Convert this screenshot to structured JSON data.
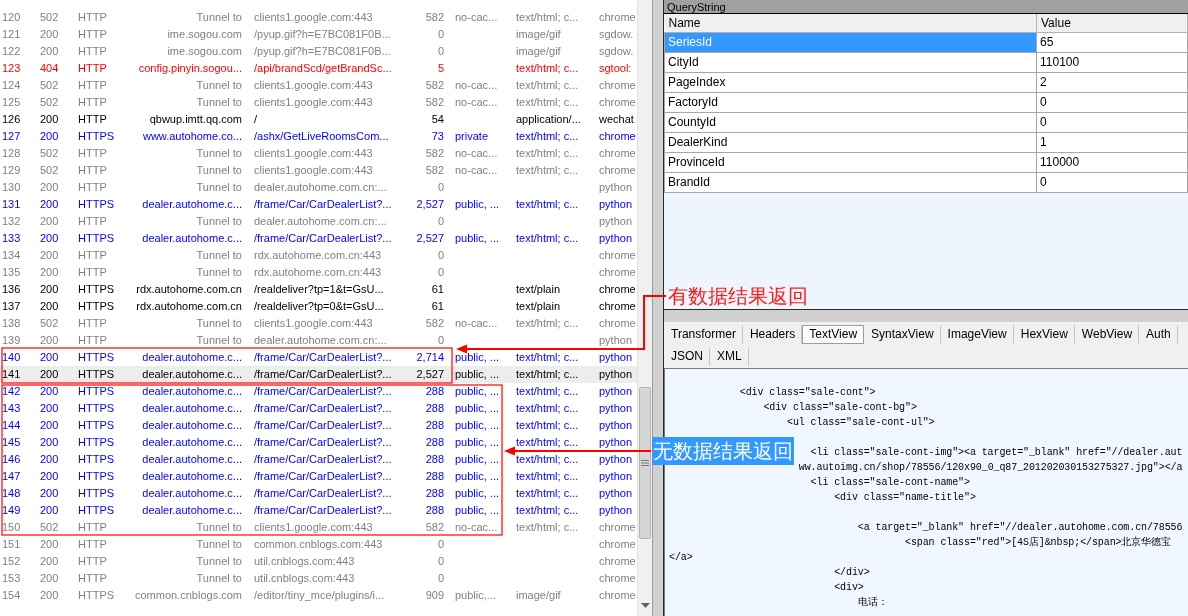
{
  "sessions": {
    "rows": [
      {
        "num": "120",
        "result": "502",
        "protocol": "HTTP",
        "host": "Tunnel to",
        "url": "clients1.google.com:443",
        "body": "582",
        "caching": "no-cac...",
        "content_type": "text/html; c...",
        "process": "chrome",
        "kind": "tunnel",
        "selected": false
      },
      {
        "num": "121",
        "result": "200",
        "protocol": "HTTP",
        "host": "ime.sogou.com",
        "url": "/pyup.gif?h=E7BC081F0B...",
        "body": "0",
        "content_type": "image/gif",
        "process": "sgdow.",
        "kind": "image",
        "selected": false
      },
      {
        "num": "122",
        "result": "200",
        "protocol": "HTTP",
        "host": "ime.sogou.com",
        "url": "/pyup.gif?h=E7BC081F0B...",
        "body": "0",
        "content_type": "image/gif",
        "process": "sgdow.",
        "kind": "image",
        "selected": false
      },
      {
        "num": "123",
        "result": "404",
        "protocol": "HTTP",
        "host": "config.pinyin.sogou...",
        "url": "/api/brandScd/getBrandSc...",
        "body": "5",
        "content_type": "text/html; c...",
        "process": "sgtool:",
        "kind": "error",
        "selected": false
      },
      {
        "num": "124",
        "result": "502",
        "protocol": "HTTP",
        "host": "Tunnel to",
        "url": "clients1.google.com:443",
        "body": "582",
        "caching": "no-cac...",
        "content_type": "text/html; c...",
        "process": "chrome",
        "kind": "tunnel",
        "selected": false
      },
      {
        "num": "125",
        "result": "502",
        "protocol": "HTTP",
        "host": "Tunnel to",
        "url": "clients1.google.com:443",
        "body": "582",
        "caching": "no-cac...",
        "content_type": "text/html; c...",
        "process": "chrome",
        "kind": "tunnel",
        "selected": false
      },
      {
        "num": "126",
        "result": "200",
        "protocol": "HTTP",
        "host": "qbwup.imtt.qq.com",
        "url": "/",
        "body": "54",
        "content_type": "application/...",
        "process": "wechat",
        "kind": "other",
        "selected": false
      },
      {
        "num": "127",
        "result": "200",
        "protocol": "HTTPS",
        "host": "www.autohome.co...",
        "url": "/ashx/GetLiveRoomsCom...",
        "body": "73",
        "caching": "private",
        "content_type": "text/html; c...",
        "process": "chrome",
        "kind": "html",
        "selected": false
      },
      {
        "num": "128",
        "result": "502",
        "protocol": "HTTP",
        "host": "Tunnel to",
        "url": "clients1.google.com:443",
        "body": "582",
        "caching": "no-cac...",
        "content_type": "text/html; c...",
        "process": "chrome",
        "kind": "tunnel",
        "selected": false
      },
      {
        "num": "129",
        "result": "502",
        "protocol": "HTTP",
        "host": "Tunnel to",
        "url": "clients1.google.com:443",
        "body": "582",
        "caching": "no-cac...",
        "content_type": "text/html; c...",
        "process": "chrome",
        "kind": "tunnel",
        "selected": false
      },
      {
        "num": "130",
        "result": "200",
        "protocol": "HTTP",
        "host": "Tunnel to",
        "url": "dealer.autohome.com.cn:...",
        "body": "0",
        "process": "python",
        "kind": "tunnel",
        "selected": false
      },
      {
        "num": "131",
        "result": "200",
        "protocol": "HTTPS",
        "host": "dealer.autohome.c...",
        "url": "/frame/Car/CarDealerList?...",
        "body": "2,527",
        "caching": "public, ...",
        "content_type": "text/html; c...",
        "process": "python",
        "kind": "html",
        "selected": false
      },
      {
        "num": "132",
        "result": "200",
        "protocol": "HTTP",
        "host": "Tunnel to",
        "url": "dealer.autohome.com.cn:...",
        "body": "0",
        "process": "python",
        "kind": "tunnel",
        "selected": false
      },
      {
        "num": "133",
        "result": "200",
        "protocol": "HTTPS",
        "host": "dealer.autohome.c...",
        "url": "/frame/Car/CarDealerList?...",
        "body": "2,527",
        "caching": "public, ...",
        "content_type": "text/html; c...",
        "process": "python",
        "kind": "html",
        "selected": false
      },
      {
        "num": "134",
        "result": "200",
        "protocol": "HTTP",
        "host": "Tunnel to",
        "url": "rdx.autohome.com.cn:443",
        "body": "0",
        "process": "chrome",
        "kind": "tunnel",
        "selected": false
      },
      {
        "num": "135",
        "result": "200",
        "protocol": "HTTP",
        "host": "Tunnel to",
        "url": "rdx.autohome.com.cn:443",
        "body": "0",
        "process": "chrome",
        "kind": "tunnel",
        "selected": false
      },
      {
        "num": "136",
        "result": "200",
        "protocol": "HTTPS",
        "host": "rdx.autohome.com.cn",
        "url": "/realdeliver?tp=1&t=GsU...",
        "body": "61",
        "content_type": "text/plain",
        "process": "chrome",
        "kind": "other",
        "selected": false
      },
      {
        "num": "137",
        "result": "200",
        "protocol": "HTTPS",
        "host": "rdx.autohome.com.cn",
        "url": "/realdeliver?tp=0&t=GsU...",
        "body": "61",
        "content_type": "text/plain",
        "process": "chrome",
        "kind": "other",
        "selected": false
      },
      {
        "num": "138",
        "result": "502",
        "protocol": "HTTP",
        "host": "Tunnel to",
        "url": "clients1.google.com:443",
        "body": "582",
        "caching": "no-cac...",
        "content_type": "text/html; c...",
        "process": "chrome",
        "kind": "tunnel",
        "selected": false
      },
      {
        "num": "139",
        "result": "200",
        "protocol": "HTTP",
        "host": "Tunnel to",
        "url": "dealer.autohome.com.cn:...",
        "body": "0",
        "process": "python",
        "kind": "tunnel",
        "selected": false
      },
      {
        "num": "140",
        "result": "200",
        "protocol": "HTTPS",
        "host": "dealer.autohome.c...",
        "url": "/frame/Car/CarDealerList?...",
        "body": "2,714",
        "caching": "public, ...",
        "content_type": "text/html; c...",
        "process": "python",
        "kind": "html",
        "selected": false
      },
      {
        "num": "141",
        "result": "200",
        "protocol": "HTTPS",
        "host": "dealer.autohome.c...",
        "url": "/frame/Car/CarDealerList?...",
        "body": "2,527",
        "caching": "public, ...",
        "content_type": "text/html; c...",
        "process": "python",
        "kind": "html",
        "selected": true
      },
      {
        "num": "142",
        "result": "200",
        "protocol": "HTTPS",
        "host": "dealer.autohome.c...",
        "url": "/frame/Car/CarDealerList?...",
        "body": "288",
        "caching": "public, ...",
        "content_type": "text/html; c...",
        "process": "python",
        "kind": "html",
        "selected": false
      },
      {
        "num": "143",
        "result": "200",
        "protocol": "HTTPS",
        "host": "dealer.autohome.c...",
        "url": "/frame/Car/CarDealerList?...",
        "body": "288",
        "caching": "public, ...",
        "content_type": "text/html; c...",
        "process": "python",
        "kind": "html",
        "selected": false
      },
      {
        "num": "144",
        "result": "200",
        "protocol": "HTTPS",
        "host": "dealer.autohome.c...",
        "url": "/frame/Car/CarDealerList?...",
        "body": "288",
        "caching": "public, ...",
        "content_type": "text/html; c...",
        "process": "python",
        "kind": "html",
        "selected": false
      },
      {
        "num": "145",
        "result": "200",
        "protocol": "HTTPS",
        "host": "dealer.autohome.c...",
        "url": "/frame/Car/CarDealerList?...",
        "body": "288",
        "caching": "public, ...",
        "content_type": "text/html; c...",
        "process": "python",
        "kind": "html",
        "selected": false
      },
      {
        "num": "146",
        "result": "200",
        "protocol": "HTTPS",
        "host": "dealer.autohome.c...",
        "url": "/frame/Car/CarDealerList?...",
        "body": "288",
        "caching": "public, ...",
        "content_type": "text/html; c...",
        "process": "python",
        "kind": "html",
        "selected": false
      },
      {
        "num": "147",
        "result": "200",
        "protocol": "HTTPS",
        "host": "dealer.autohome.c...",
        "url": "/frame/Car/CarDealerList?...",
        "body": "288",
        "caching": "public, ...",
        "content_type": "text/html; c...",
        "process": "python",
        "kind": "html",
        "selected": false
      },
      {
        "num": "148",
        "result": "200",
        "protocol": "HTTPS",
        "host": "dealer.autohome.c...",
        "url": "/frame/Car/CarDealerList?...",
        "body": "288",
        "caching": "public, ...",
        "content_type": "text/html; c...",
        "process": "python",
        "kind": "html",
        "selected": false
      },
      {
        "num": "149",
        "result": "200",
        "protocol": "HTTPS",
        "host": "dealer.autohome.c...",
        "url": "/frame/Car/CarDealerList?...",
        "body": "288",
        "caching": "public, ...",
        "content_type": "text/html; c...",
        "process": "python",
        "kind": "html",
        "selected": false
      },
      {
        "num": "150",
        "result": "502",
        "protocol": "HTTP",
        "host": "Tunnel to",
        "url": "clients1.google.com:443",
        "body": "582",
        "caching": "no-cac...",
        "content_type": "text/html; c...",
        "process": "chrome",
        "kind": "tunnel",
        "selected": false
      },
      {
        "num": "151",
        "result": "200",
        "protocol": "HTTP",
        "host": "Tunnel to",
        "url": "common.cnblogs.com:443",
        "body": "0",
        "process": "chrome",
        "kind": "tunnel",
        "selected": false
      },
      {
        "num": "152",
        "result": "200",
        "protocol": "HTTP",
        "host": "Tunnel to",
        "url": "util.cnblogs.com:443",
        "body": "0",
        "process": "chrome",
        "kind": "tunnel",
        "selected": false
      },
      {
        "num": "153",
        "result": "200",
        "protocol": "HTTP",
        "host": "Tunnel to",
        "url": "util.cnblogs.com:443",
        "body": "0",
        "process": "chrome",
        "kind": "tunnel",
        "selected": false
      },
      {
        "num": "154",
        "result": "200",
        "protocol": "HTTPS",
        "host": "common.cnblogs.com",
        "url": "/editor/tiny_mce/plugins/i...",
        "body": "909",
        "caching": "public,...",
        "content_type": "image/gif",
        "process": "chrome",
        "kind": "image",
        "selected": false
      }
    ]
  },
  "query_string": {
    "title": "QueryString",
    "columns": [
      "Name",
      "Value"
    ],
    "rows": [
      {
        "name": "SeriesId",
        "value": "65",
        "selected": true
      },
      {
        "name": "CityId",
        "value": "110100",
        "selected": false
      },
      {
        "name": "PageIndex",
        "value": "2",
        "selected": false
      },
      {
        "name": "FactoryId",
        "value": "0",
        "selected": false
      },
      {
        "name": "CountyId",
        "value": "0",
        "selected": false
      },
      {
        "name": "DealerKind",
        "value": "1",
        "selected": false
      },
      {
        "name": "ProvinceId",
        "value": "110000",
        "selected": false
      },
      {
        "name": "BrandId",
        "value": "0",
        "selected": false
      }
    ]
  },
  "inspector": {
    "tab_rows": [
      {
        "tabs": [
          {
            "label": "Transformer",
            "selected": false
          },
          {
            "label": "Headers",
            "selected": false
          },
          {
            "label": "TextView",
            "selected": true
          },
          {
            "label": "SyntaxView",
            "selected": false
          },
          {
            "label": "ImageView",
            "selected": false
          },
          {
            "label": "HexView",
            "selected": false
          },
          {
            "label": "WebView",
            "selected": false
          },
          {
            "label": "Auth",
            "selected": false
          }
        ]
      },
      {
        "tabs": [
          {
            "label": "JSON",
            "selected": false
          },
          {
            "label": "XML",
            "selected": false
          }
        ]
      }
    ],
    "text_view": {
      "text": "            <div class=\"sale-cont\">\n                <div class=\"sale-cont-bg\">\n                    <ul class=\"sale-cont-ul\">\n\n                        <li class=\"sale-cont-img\"><a target=\"_blank\" href=\"//dealer.aut\n                      ww.autoimg.cn/shop/78556/120x90_0_q87_201202030153275327.jpg\"></a\n                        <li class=\"sale-cont-name\">\n                            <div class=\"name-title\">\n\n                                <a target=\"_blank\" href=\"//dealer.autohome.com.cn/78556\n                                        <span class=\"red\">[4S店]&nbsp;</span>北京华德宝\n</a>\n                            </div>\n                            <div>\n                                电话："
    }
  },
  "annotations": [
    {
      "text": "有数据结果返回",
      "kind": "text"
    },
    {
      "text": "无数据结果返回",
      "kind": "tag"
    }
  ]
}
